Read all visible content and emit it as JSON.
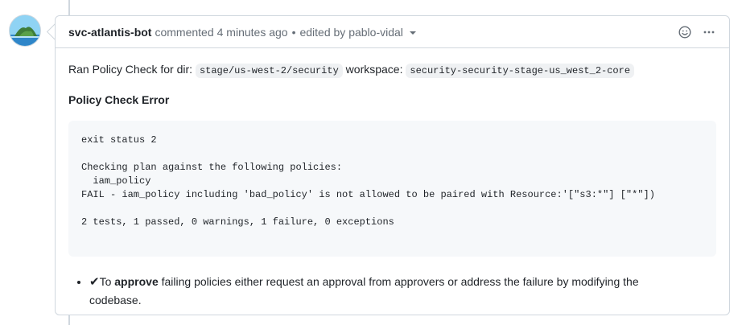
{
  "comment": {
    "author": "svc-atlantis-bot",
    "action": "commented",
    "time": "4 minutes ago",
    "separator": "•",
    "edited_label": "edited by pablo-vidal",
    "icons": [
      "smiley-icon",
      "kebab-menu-icon"
    ]
  },
  "body": {
    "intro_text": "Ran Policy Check for dir:",
    "dir": "stage/us-west-2/security",
    "workspace_label": "workspace:",
    "workspace": "security-security-stage-us_west_2-core",
    "heading": "Policy Check Error",
    "code_block": "exit status 2\n\nChecking plan against the following policies:\n  iam_policy\nFAIL - iam_policy including 'bad_policy' is not allowed to be paired with Resource:'[\"s3:*\"] [\"*\"])\n\n2 tests, 1 passed, 0 warnings, 1 failure, 0 exceptions",
    "note_check": "✔",
    "note_prefix": "To ",
    "note_bold": "approve",
    "note_rest": " failing policies either request an approval from approvers or address the failure by modifying the codebase."
  },
  "colors": {
    "border": "#d0d7de",
    "muted": "#656d76",
    "code_bg": "#f6f8fa"
  }
}
